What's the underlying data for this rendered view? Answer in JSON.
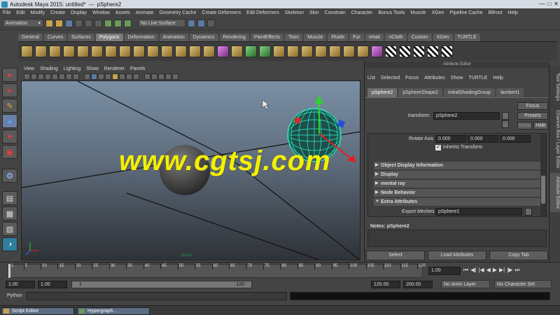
{
  "window": {
    "title": "Autodesk Maya 2015: untitled*",
    "sep": "---",
    "object": "pSphere2"
  },
  "menus": [
    "File",
    "Edit",
    "Modify",
    "Create",
    "Display",
    "Window",
    "Assets",
    "Animate",
    "Geometry Cache",
    "Create Deformers",
    "Edit Deformers",
    "Skeleton",
    "Skin",
    "Constrain",
    "Character",
    "Bonus Tools",
    "Muscle",
    "XGen",
    "Pipeline Cache",
    "Bifrost",
    "Help"
  ],
  "status_line": {
    "mode": "Animation",
    "live_surface": "No Live Surface"
  },
  "shelf_tabs": [
    "General",
    "Curves",
    "Surfaces",
    "Polygons",
    "Deformation",
    "Animation",
    "Dynamics",
    "Rendering",
    "PaintEffects",
    "Toon",
    "Muscle",
    "Fluids",
    "Fur",
    "nHair",
    "nCloth",
    "Custom",
    "XGen",
    "TURTLE"
  ],
  "shelf_active": "Polygons",
  "panel_menu": [
    "View",
    "Shading",
    "Lighting",
    "Show",
    "Renderer",
    "Panels"
  ],
  "viewport": {
    "watermark": "www.cgtsj.com",
    "camera_label": "persp"
  },
  "attribute_editor": {
    "header": "Attribute Editor",
    "menu": [
      "List",
      "Selected",
      "Focus",
      "Attributes",
      "Show",
      "TURTLE",
      "Help"
    ],
    "tabs": [
      "pSphere2",
      "pSphereShape2",
      "initialShadingGroup",
      "lambert1"
    ],
    "transform_label": "transform:",
    "transform_value": "pSphere2",
    "focus_btn": "Focus",
    "presets_btn": "Presets",
    "show_btn": "Show",
    "hide_btn": "Hide",
    "rotate_axis_label": "Rotate Axis",
    "rotate_axis": [
      "0.000",
      "0.000",
      "0.000"
    ],
    "inherits_transform": "Inherits Transform",
    "sections": [
      "Object Display Information",
      "Display",
      "mental ray",
      "Node Behavior",
      "Extra Attributes"
    ],
    "export_meshes_label": "Export Meshes",
    "export_meshes_value": "pSphere1",
    "notes_label": "Notes: pSphere2",
    "bottom_buttons": [
      "Select",
      "Load Attributes",
      "Copy Tab"
    ]
  },
  "right_tabs": [
    "Tool Settings",
    "Channel Box / Layer Editor",
    "Attribute Editor"
  ],
  "timeline": {
    "ticks": [
      "1",
      "5",
      "10",
      "15",
      "20",
      "25",
      "30",
      "35",
      "40",
      "45",
      "50",
      "55",
      "60",
      "65",
      "70",
      "75",
      "80",
      "85",
      "90",
      "95",
      "100",
      "105",
      "110",
      "115",
      "120"
    ],
    "current": "1.00"
  },
  "range": {
    "start": "1.00",
    "inner_start": "1.00",
    "slider_left": "1",
    "slider_right": "120",
    "end": "120.00",
    "outer_end": "200.00",
    "anim_layer": "No Anim Layer",
    "character": "No Character Set"
  },
  "command_line": {
    "label": "Python"
  },
  "taskbar": [
    "Script Editor",
    "Hypergraph..."
  ]
}
